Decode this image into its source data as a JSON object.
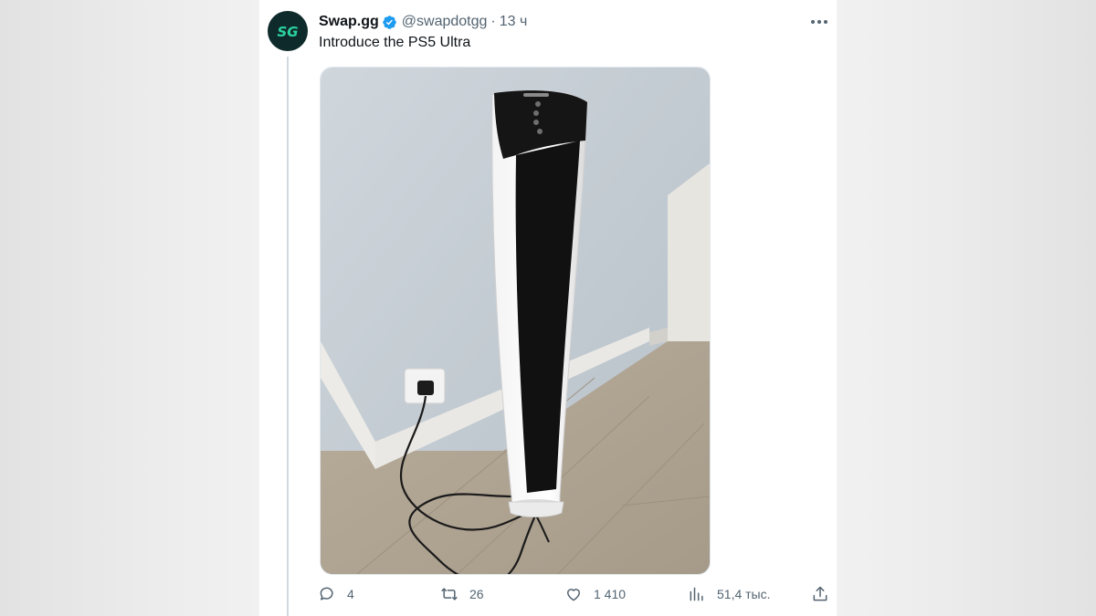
{
  "tweet": {
    "author": {
      "display_name": "Swap.gg",
      "handle": "@swapdotgg",
      "avatar_logo_text": "SG",
      "verified": true
    },
    "separator": "·",
    "time": "13 ч",
    "text": "Introduce the PS5 Ultra",
    "media": {
      "icon": "photo-of-tower-fan-like-white-black-device"
    },
    "actions": {
      "reply": {
        "icon": "reply-icon",
        "count": "4"
      },
      "retweet": {
        "icon": "retweet-icon",
        "count": "26"
      },
      "like": {
        "icon": "heart-icon",
        "count": "1 410"
      },
      "views": {
        "icon": "views-chart-icon",
        "count": "51,4 тыс."
      },
      "share": {
        "icon": "share-icon"
      }
    }
  },
  "colors": {
    "text_primary": "#0f1419",
    "text_secondary": "#536471",
    "verified_blue": "#1d9bf0",
    "avatar_bg": "#0f2a2b",
    "avatar_logo": "#2bd4a0"
  }
}
